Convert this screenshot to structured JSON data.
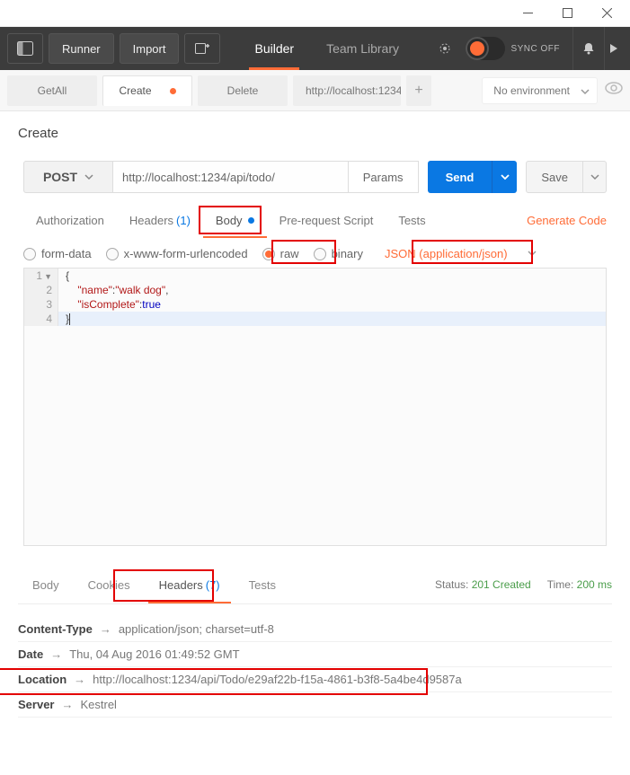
{
  "window": {
    "title": ""
  },
  "topbar": {
    "runner": "Runner",
    "import": "Import",
    "builder": "Builder",
    "library": "Team Library",
    "sync": "SYNC OFF"
  },
  "tabs": {
    "items": [
      "GetAll",
      "Create",
      "Delete",
      "http://localhost:1234"
    ],
    "activeIndex": 1
  },
  "env": {
    "label": "No environment"
  },
  "request": {
    "name": "Create",
    "method": "POST",
    "url": "http://localhost:1234/api/todo/",
    "params": "Params",
    "send": "Send",
    "save": "Save"
  },
  "reqTabs": {
    "authorization": "Authorization",
    "headers": "Headers",
    "headersCount": "(1)",
    "body": "Body",
    "prerequest": "Pre-request Script",
    "tests": "Tests",
    "generate": "Generate Code"
  },
  "bodyTypes": {
    "formdata": "form-data",
    "urlencoded": "x-www-form-urlencoded",
    "raw": "raw",
    "binary": "binary",
    "contentType": "JSON (application/json)"
  },
  "editor": {
    "lines": [
      "1",
      "2",
      "3",
      "4"
    ],
    "l1": "{",
    "l2_key": "\"name\"",
    "l2_sep": ":",
    "l2_val": "\"walk dog\"",
    "l2_comma": ",",
    "l3_key": "\"isComplete\"",
    "l3_sep": ":",
    "l3_val": "true",
    "l4": "}"
  },
  "response": {
    "tabs": {
      "body": "Body",
      "cookies": "Cookies",
      "headers": "Headers",
      "headersCount": "(7)",
      "tests": "Tests"
    },
    "statusLabel": "Status:",
    "statusValue": "201 Created",
    "timeLabel": "Time:",
    "timeValue": "200 ms",
    "headers": {
      "contentTypeK": "Content-Type",
      "contentTypeV": "application/json; charset=utf-8",
      "dateK": "Date",
      "dateV": "Thu, 04 Aug 2016 01:49:52 GMT",
      "locationK": "Location",
      "locationV": "http://localhost:1234/api/Todo/e29af22b-f15a-4861-b3f8-5a4be4d9587a",
      "serverK": "Server",
      "serverV": "Kestrel"
    }
  }
}
